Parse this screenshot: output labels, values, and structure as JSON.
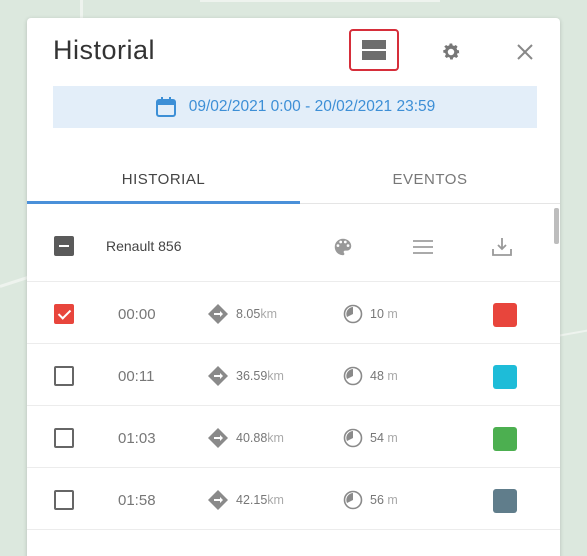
{
  "panel": {
    "title": "Historial",
    "date_range": "09/02/2021 0:00 - 20/02/2021 23:59"
  },
  "tabs": [
    {
      "label": "HISTORIAL",
      "active": true
    },
    {
      "label": "EVENTOS",
      "active": false
    }
  ],
  "vehicle": {
    "name": "Renault 856",
    "checkbox_state": "indeterminate"
  },
  "trips": [
    {
      "time": "00:00",
      "distance": "8.05",
      "distance_unit": "km",
      "duration": "10",
      "duration_unit": "m",
      "color": "#e8453c",
      "checked": true
    },
    {
      "time": "00:11",
      "distance": "36.59",
      "distance_unit": "km",
      "duration": "48",
      "duration_unit": "m",
      "color": "#1ebcd8",
      "checked": false
    },
    {
      "time": "01:03",
      "distance": "40.88",
      "distance_unit": "km",
      "duration": "54",
      "duration_unit": "m",
      "color": "#4caf50",
      "checked": false
    },
    {
      "time": "01:58",
      "distance": "42.15",
      "distance_unit": "km",
      "duration": "56",
      "duration_unit": "m",
      "color": "#607d8b",
      "checked": false
    }
  ],
  "icons": {
    "layers": "layers-icon",
    "settings": "gear-icon",
    "close": "close-icon",
    "calendar": "calendar-icon",
    "palette": "palette-icon",
    "list": "list-icon",
    "download": "download-icon",
    "distance": "route-icon",
    "duration": "clock-icon"
  },
  "colors": {
    "accent": "#4a90d9",
    "highlight_border": "#d62e3a",
    "date_bg": "#e3eef9"
  }
}
